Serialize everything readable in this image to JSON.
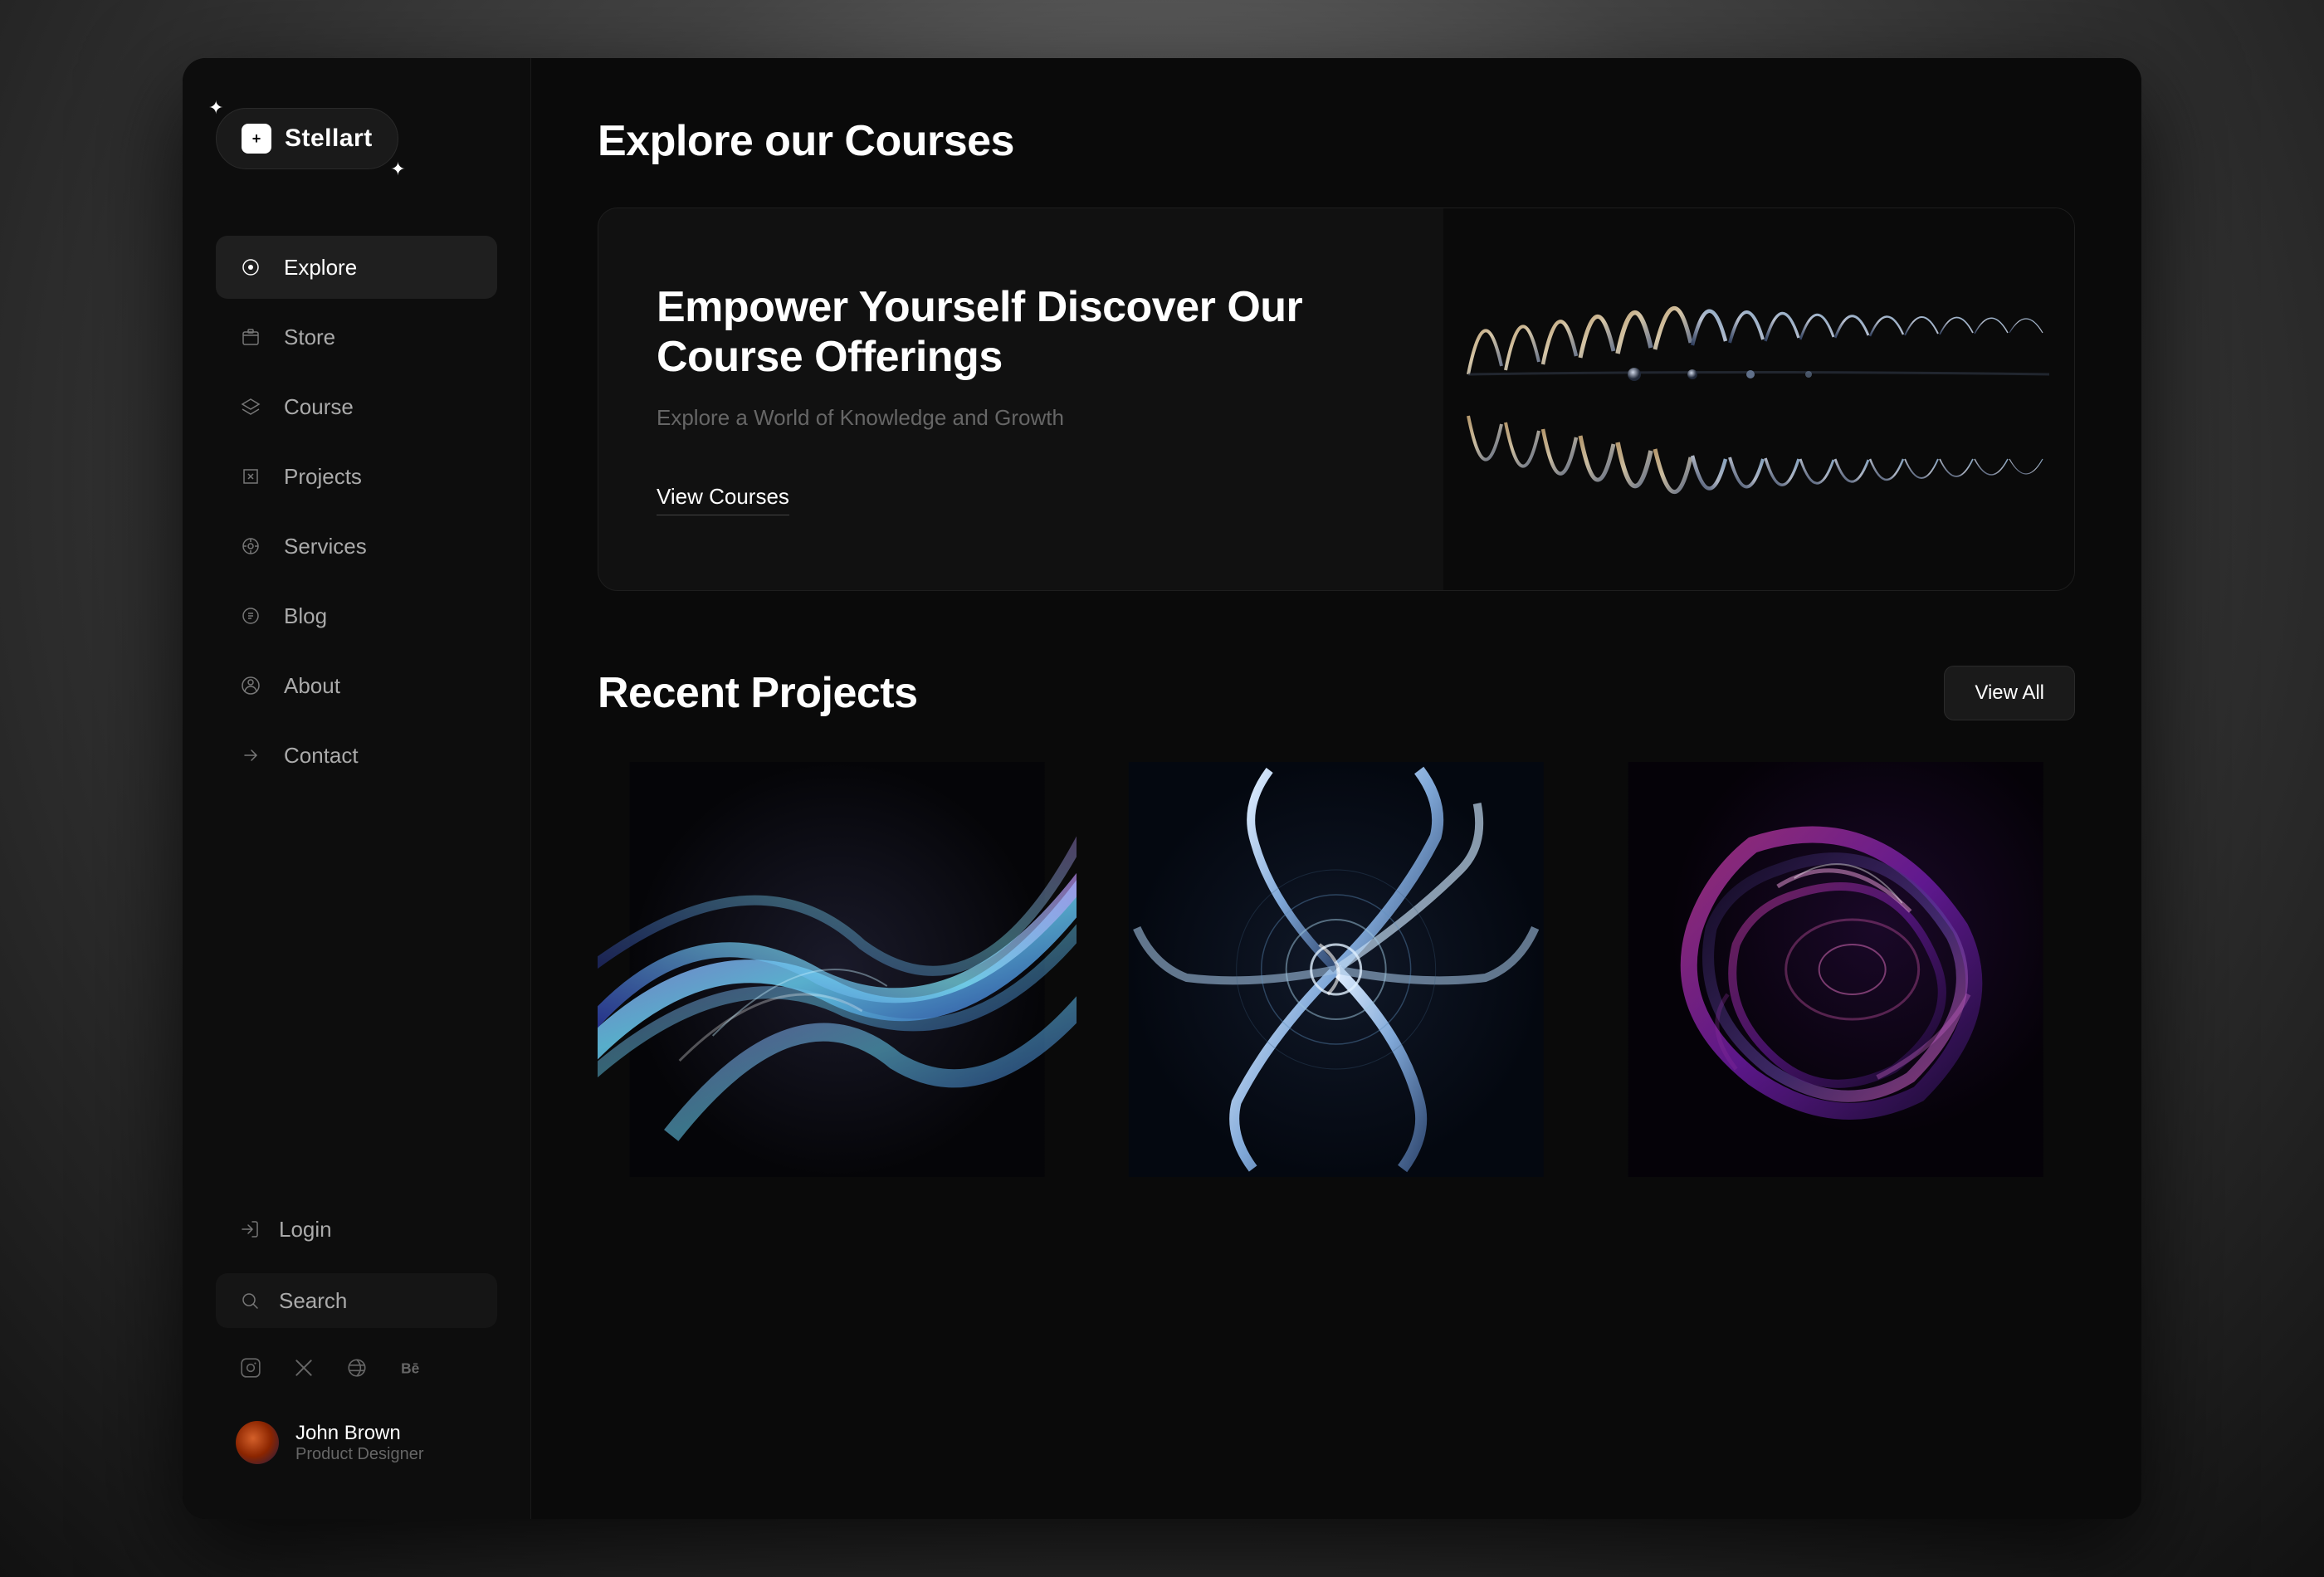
{
  "app": {
    "name": "Stellart",
    "logo_icon": "✦"
  },
  "sidebar": {
    "nav_items": [
      {
        "id": "explore",
        "label": "Explore",
        "icon": "◎",
        "active": true
      },
      {
        "id": "store",
        "label": "Store",
        "icon": "⊟"
      },
      {
        "id": "course",
        "label": "Course",
        "icon": "⬟"
      },
      {
        "id": "projects",
        "label": "Projects",
        "icon": "✐"
      },
      {
        "id": "services",
        "label": "Services",
        "icon": "⊕"
      },
      {
        "id": "blog",
        "label": "Blog",
        "icon": "◉"
      },
      {
        "id": "about",
        "label": "About",
        "icon": "○"
      },
      {
        "id": "contact",
        "label": "Contact",
        "icon": "▷"
      }
    ],
    "bottom": {
      "login_label": "Login",
      "search_label": "Search",
      "social": [
        "instagram",
        "twitter-x",
        "dribbble",
        "behance"
      ],
      "user": {
        "name": "John Brown",
        "role": "Product Designer"
      }
    }
  },
  "main": {
    "courses": {
      "section_title": "Explore our Courses",
      "banner_heading": "Empower Yourself Discover Our Course Offerings",
      "banner_sub": "Explore a World of Knowledge and Growth",
      "view_courses_label": "View Courses"
    },
    "projects": {
      "section_title": "Recent Projects",
      "view_all_label": "View All",
      "items": [
        {
          "id": "project-1",
          "alt": "Abstract metallic ribbons"
        },
        {
          "id": "project-2",
          "alt": "Spiral metallic structure"
        },
        {
          "id": "project-3",
          "alt": "Purple metallic abstract"
        }
      ]
    }
  }
}
